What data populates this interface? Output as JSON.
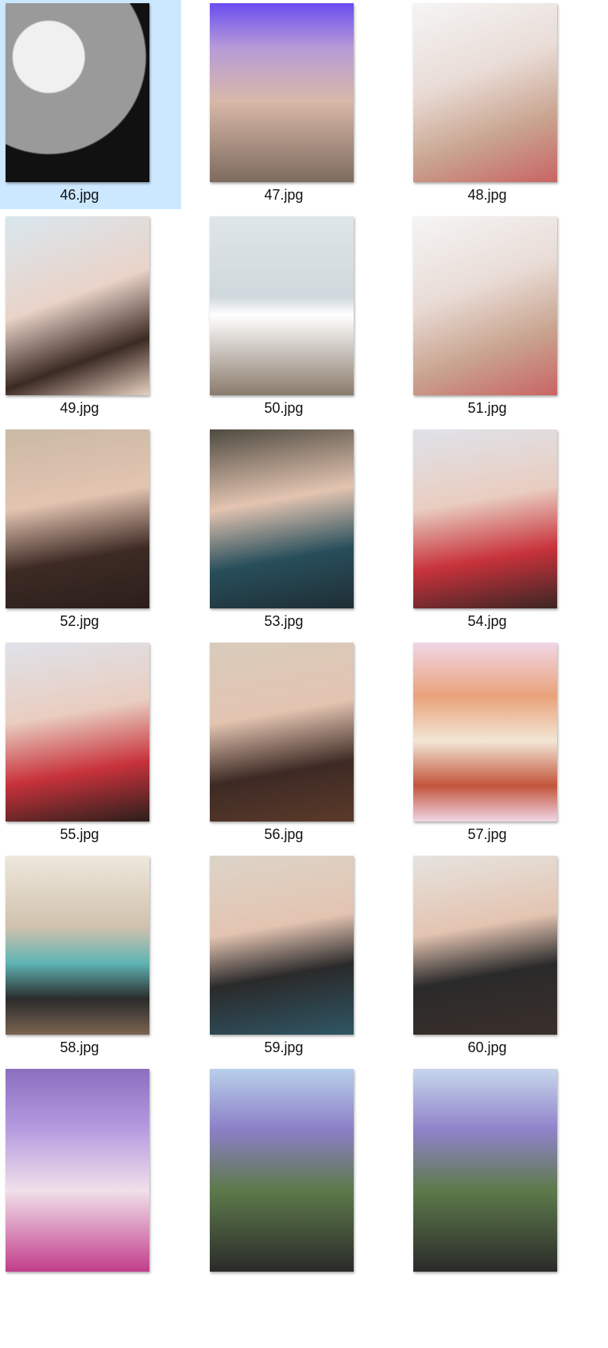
{
  "files": [
    {
      "name": "46.jpg",
      "selected": true,
      "thumb": "t46",
      "icon": "image-thumbnail-moon-tree-painting"
    },
    {
      "name": "47.jpg",
      "selected": false,
      "thumb": "t47",
      "icon": "image-thumbnail-three-women"
    },
    {
      "name": "48.jpg",
      "selected": false,
      "thumb": "t48",
      "icon": "image-thumbnail-woman-balloons"
    },
    {
      "name": "49.jpg",
      "selected": false,
      "thumb": "t49",
      "icon": "image-thumbnail-woman-selfie"
    },
    {
      "name": "50.jpg",
      "selected": false,
      "thumb": "t50",
      "icon": "image-thumbnail-woman-yacht"
    },
    {
      "name": "51.jpg",
      "selected": false,
      "thumb": "t51",
      "icon": "image-thumbnail-woman-balloons"
    },
    {
      "name": "52.jpg",
      "selected": false,
      "thumb": "t52",
      "icon": "image-thumbnail-woman-portrait"
    },
    {
      "name": "53.jpg",
      "selected": false,
      "thumb": "t53",
      "icon": "image-thumbnail-woman-fur-coat"
    },
    {
      "name": "54.jpg",
      "selected": false,
      "thumb": "t54",
      "icon": "image-thumbnail-two-women-roses"
    },
    {
      "name": "55.jpg",
      "selected": false,
      "thumb": "t55",
      "icon": "image-thumbnail-two-women-roses"
    },
    {
      "name": "56.jpg",
      "selected": false,
      "thumb": "t56",
      "icon": "image-thumbnail-woman-portrait"
    },
    {
      "name": "57.jpg",
      "selected": false,
      "thumb": "t57",
      "icon": "image-thumbnail-food-collage"
    },
    {
      "name": "58.jpg",
      "selected": false,
      "thumb": "t58",
      "icon": "image-thumbnail-woman-chair"
    },
    {
      "name": "59.jpg",
      "selected": false,
      "thumb": "t59",
      "icon": "image-thumbnail-two-women"
    },
    {
      "name": "60.jpg",
      "selected": false,
      "thumb": "t60",
      "icon": "image-thumbnail-two-women"
    },
    {
      "name": "",
      "selected": false,
      "thumb": "t61",
      "icon": "image-thumbnail-three-women-kimono"
    },
    {
      "name": "",
      "selected": false,
      "thumb": "t62",
      "icon": "image-thumbnail-woman-kimono-wisteria"
    },
    {
      "name": "",
      "selected": false,
      "thumb": "t63",
      "icon": "image-thumbnail-woman-kimono-wisteria"
    }
  ],
  "colors": {
    "selection_bg": "#cce8ff",
    "label_text": "#111111"
  }
}
